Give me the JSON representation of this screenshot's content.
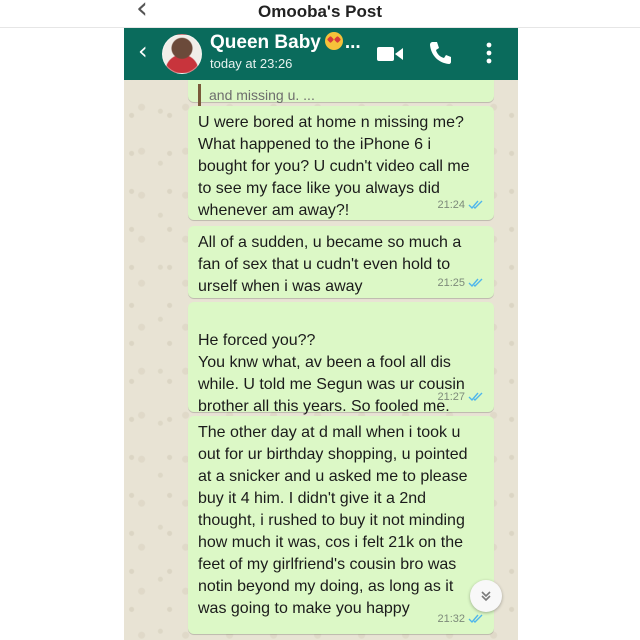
{
  "post": {
    "title": "Omooba's Post"
  },
  "chat": {
    "contact_name": "Queen Baby",
    "contact_emoji": "star-struck-emoji",
    "contact_ellipsis": "...",
    "last_seen": "today at 23:26",
    "header_color": "#0a6b5c",
    "bubble_color": "#dcf8c6",
    "tick_color": "#4fb6ec",
    "messages": [
      {
        "quote": "and missing u. ...",
        "text": "",
        "time": ""
      },
      {
        "text": "U were bored at home n missing me? What happened to the iPhone 6 i bought for you? U cudn't video call me to see my face like you always did whenever am away?!",
        "time": "21:24"
      },
      {
        "text": "All of a sudden, u became so much a fan of sex that u cudn't even hold to urself when i was away",
        "time": "21:25"
      },
      {
        "text": "He forced you??\nYou knw what, av been a fool all dis while. U told me Segun was ur cousin brother all this years. So fooled me.",
        "time": "21:27"
      },
      {
        "text": "The other day at d mall when i took u out for ur birthday shopping, u pointed at a snicker and u asked me to please buy it 4 him. I didn't give it a 2nd thought, i rushed to buy it not minding how much it was, cos i felt 21k on the feet of my girlfriend's cousin bro was notin beyond my doing, as long as it was going to make you happy",
        "time": "21:32"
      }
    ]
  }
}
